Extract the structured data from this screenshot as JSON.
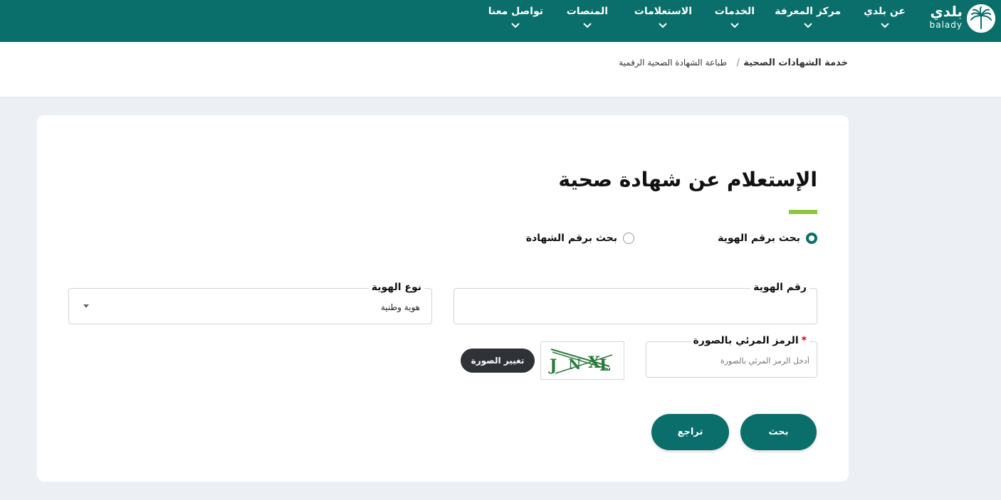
{
  "brand": {
    "name_ar": "بلدي",
    "name_en": "balady"
  },
  "nav": [
    {
      "label": "عن بلدي"
    },
    {
      "label": "مركز المعرفة"
    },
    {
      "label": "الخدمات"
    },
    {
      "label": "الاستعلامات"
    },
    {
      "label": "المنصات"
    },
    {
      "label": "تواصل معنا"
    }
  ],
  "breadcrumb": {
    "parent": "خدمة الشهادات الصحية",
    "separator": "/",
    "current": "طباعة الشهادة الصحية الرقمية"
  },
  "form": {
    "title": "الإستعلام عن شهادة صحية",
    "radio_by_id": "بحث برقم الهوية",
    "radio_by_cert": "بحث برقم الشهادة",
    "selected_radio": "radio_by_id",
    "id_type_label": "نوع الهوية",
    "id_type_value": "هوية وطنية",
    "id_number_label": "رقم الهوية",
    "id_number_value": "",
    "captcha_label": "الرمز المرئي بالصورة",
    "captcha_required_mark": "*",
    "captcha_placeholder": "أدخل الرمز المرئي بالصورة",
    "captcha_text": "JNXL",
    "change_image_label": "تغيير الصورة",
    "search_label": "بحث",
    "back_label": "تراجع"
  },
  "colors": {
    "primary": "#0a6e6b",
    "accent": "#8cc63f",
    "dark": "#2f3338",
    "required": "#d0021b"
  }
}
